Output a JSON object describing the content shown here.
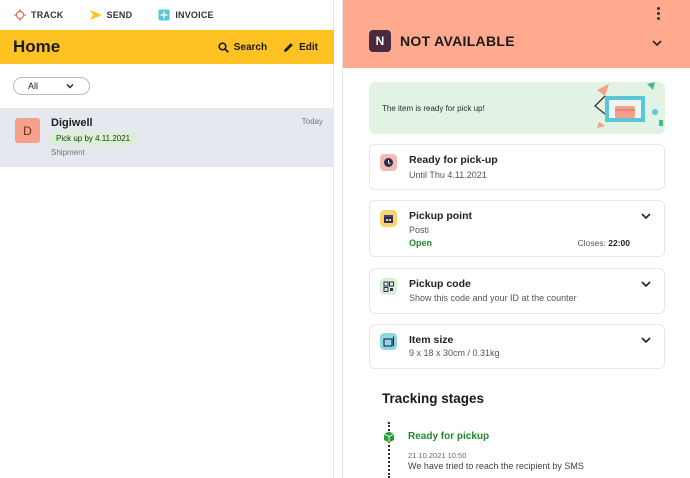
{
  "nav": [
    {
      "label": "TRACK",
      "icon": "crosshair-icon",
      "color": "#e06b5a"
    },
    {
      "label": "SEND",
      "icon": "send-arrow-icon",
      "color": "#ffc222"
    },
    {
      "label": "INVOICE",
      "icon": "invoice-icon",
      "color": "#5bc6d6"
    }
  ],
  "header": {
    "title": "Home",
    "search_label": "Search",
    "edit_label": "Edit",
    "color": "#ffc222"
  },
  "filter": {
    "selected": "All"
  },
  "shipments": [
    {
      "avatar": "D",
      "name": "Digiwell",
      "date": "Today",
      "badge": "Pick up by 4.11.2021",
      "type": "Shipment"
    }
  ],
  "detail": {
    "logo_letter": "N",
    "status": "NOT AVAILABLE",
    "header_color": "#ffa98f",
    "banner_text": "The item is ready for pick up!",
    "cards": {
      "ready": {
        "title": "Ready for pick-up",
        "subtitle": "Until Thu 4.11.2021"
      },
      "pickup_point": {
        "title": "Pickup point",
        "subtitle": "Posti",
        "open_label": "Open",
        "closes_label": "Closes:",
        "closes_time": "22:00"
      },
      "pickup_code": {
        "title": "Pickup code",
        "subtitle": "Show this code and your ID at the counter"
      },
      "item_size": {
        "title": "Item size",
        "subtitle": "9 x 18 x 30cm / 0.31kg"
      }
    },
    "tracking": {
      "title": "Tracking stages",
      "stages": [
        {
          "title": "Ready for pickup",
          "time": "21.10.2021 10:50",
          "description": "We have tried to reach the recipient by SMS"
        }
      ]
    }
  }
}
